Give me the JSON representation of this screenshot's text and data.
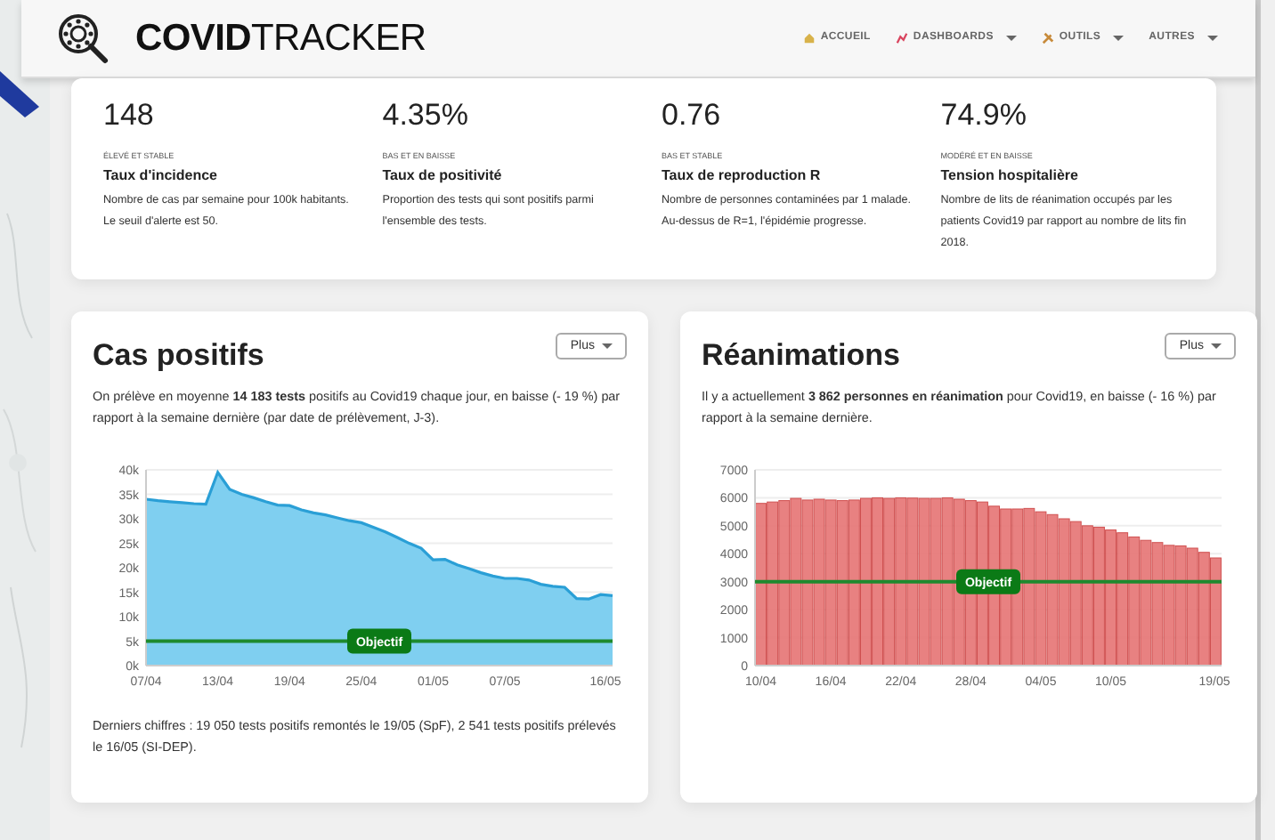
{
  "navbar": {
    "brand": "**COVID**TRACKER",
    "items": [
      {
        "label": "ACCUEIL",
        "dropdown": false
      },
      {
        "label": "DASHBOARDS",
        "dropdown": true
      },
      {
        "label": "OUTILS",
        "dropdown": true
      },
      {
        "label": "AUTRES",
        "dropdown": true
      }
    ]
  },
  "indicators": [
    {
      "value": "148",
      "status": "ÉLEVÉ ET STABLE",
      "title": "Taux d'incidence",
      "description": "Nombre de cas par semaine pour 100k habitants. Le seuil d'alerte est 50."
    },
    {
      "value": "4.35%",
      "status": "BAS ET EN BAISSE",
      "title": "Taux de positivité",
      "description": "Proportion des tests qui sont positifs parmi l'ensemble des tests."
    },
    {
      "value": "0.76",
      "status": "BAS ET STABLE",
      "title": "Taux de reproduction R",
      "description": "Nombre de personnes contaminées par 1 malade. Au-dessus de R=1, l'épidémie progresse."
    },
    {
      "value": "74.9%",
      "status": "MODÉRÉ ET EN BAISSE",
      "title": "Tension hospitalière",
      "description": "Nombre de lits de réanimation occupés par les patients Covid19 par rapport au nombre de lits fin 2018."
    }
  ],
  "panels": [
    {
      "title": "Cas positifs",
      "button": "Plus",
      "summary": "On prélève en moyenne **14 183 tests** positifs au Covid19 chaque jour, en baisse (- 19 %) par rapport à la semaine dernière (par date de prélèvement, J-3).",
      "footer": "Derniers chiffres : 19 050 tests positifs remontés le 19/05 (SpF), 2 541 tests positifs prélevés le 16/05 (SI-DEP).",
      "chart_data": {
        "type": "area",
        "categories": [
          "07/04",
          null,
          null,
          null,
          null,
          null,
          "13/04",
          null,
          null,
          null,
          null,
          null,
          "19/04",
          null,
          null,
          null,
          null,
          null,
          "25/04",
          null,
          null,
          null,
          null,
          null,
          "01/05",
          null,
          null,
          null,
          null,
          null,
          "07/05",
          null,
          null,
          null,
          null,
          null,
          null,
          null,
          null,
          "16/05"
        ],
        "series": [
          {
            "color": "#2a9fd6",
            "values": [
              34000,
              33700,
              33500,
              33300,
              33100,
              33000,
              39500,
              36000,
              35000,
              34300,
              33500,
              32800,
              32700,
              31800,
              31200,
              30800,
              30200,
              29600,
              29200,
              28300,
              27300,
              26200,
              25000,
              24000,
              21600,
              21700,
              20600,
              19800,
              19000,
              18300,
              17800,
              17800,
              17500,
              16600,
              16200,
              16000,
              13700,
              13600,
              14500,
              14300
            ]
          }
        ],
        "ylim": [
          0,
          40000
        ],
        "yticks": [
          {
            "value": 0,
            "label": "0k"
          },
          {
            "value": 5000,
            "label": "5k"
          },
          {
            "value": 10000,
            "label": "10k"
          },
          {
            "value": 15000,
            "label": "15k"
          },
          {
            "value": 20000,
            "label": "20k"
          },
          {
            "value": 25000,
            "label": "25k"
          },
          {
            "value": 30000,
            "label": "30k"
          },
          {
            "value": 35000,
            "label": "35k"
          },
          {
            "value": 40000,
            "label": "40k"
          }
        ],
        "grid": true,
        "ref_lines": [
          {
            "axis": "y",
            "value": 5000,
            "label": "Objectif",
            "color": "#1e8a2e"
          }
        ]
      }
    },
    {
      "title": "Réanimations",
      "button": "Plus",
      "summary": "Il y a actuellement **3 862 personnes en réanimation** pour Covid19, en baisse (- 16 %) par rapport à la semaine dernière.",
      "chart_data": {
        "type": "bar",
        "categories": [
          "10/04",
          null,
          null,
          null,
          null,
          null,
          "16/04",
          null,
          null,
          null,
          null,
          null,
          "22/04",
          null,
          null,
          null,
          null,
          null,
          "28/04",
          null,
          null,
          null,
          null,
          null,
          "04/05",
          null,
          null,
          null,
          null,
          null,
          "10/05",
          null,
          null,
          null,
          null,
          null,
          null,
          null,
          null,
          "19/05"
        ],
        "series": [
          {
            "color": "#e57373",
            "values": [
              5800,
              5850,
              5900,
              5980,
              5920,
              5950,
              5920,
              5900,
              5920,
              5980,
              6000,
              5980,
              6000,
              5990,
              5980,
              5980,
              6000,
              5950,
              5900,
              5850,
              5700,
              5600,
              5600,
              5620,
              5500,
              5400,
              5250,
              5150,
              5000,
              4950,
              4850,
              4750,
              4600,
              4480,
              4400,
              4300,
              4280,
              4200,
              4050,
              3850
            ]
          }
        ],
        "ylim": [
          0,
          7000
        ],
        "yticks": [
          0,
          1000,
          2000,
          3000,
          4000,
          5000,
          6000,
          7000
        ],
        "grid": true,
        "ref_lines": [
          {
            "axis": "y",
            "value": 3000,
            "label": "Objectif",
            "color": "#1e8a2e"
          }
        ]
      }
    }
  ]
}
